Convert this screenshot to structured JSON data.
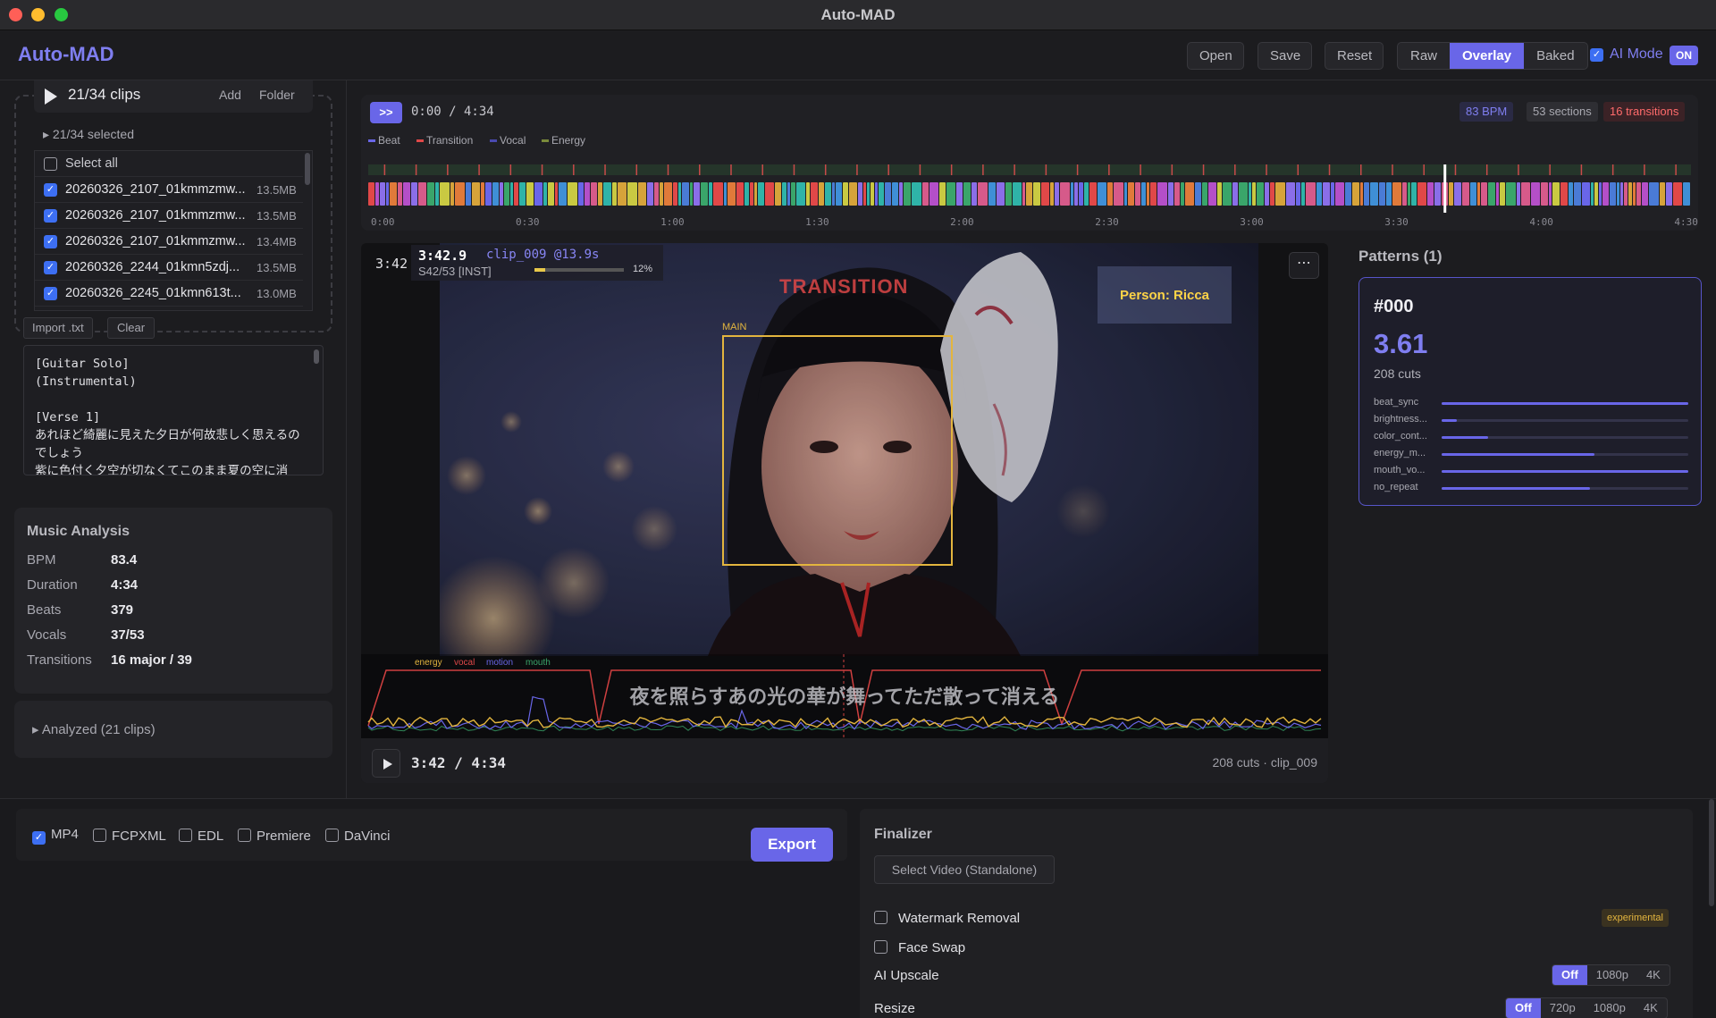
{
  "window": {
    "title": "Auto-MAD"
  },
  "header": {
    "logo": "Auto-MAD",
    "buttons": {
      "open": "Open",
      "save": "Save",
      "reset": "Reset"
    },
    "view_modes": [
      "Raw",
      "Overlay",
      "Baked"
    ],
    "active_view": "Overlay",
    "ai_mode_label": "AI Mode",
    "ai_mode_state": "ON"
  },
  "clips": {
    "count_label": "21/34 clips",
    "add_label": "Add",
    "folder_label": "Folder",
    "selected_summary": "▸ 21/34 selected",
    "select_all": "Select all",
    "items": [
      {
        "name": "20260326_2107_01kmmzmw...",
        "size": "13.5MB"
      },
      {
        "name": "20260326_2107_01kmmzmw...",
        "size": "13.5MB"
      },
      {
        "name": "20260326_2107_01kmmzmw...",
        "size": "13.4MB"
      },
      {
        "name": "20260326_2244_01kmn5zdj...",
        "size": "13.5MB"
      },
      {
        "name": "20260326_2245_01kmn613t...",
        "size": "13.0MB"
      }
    ],
    "import_label": "Import .txt",
    "clear_label": "Clear"
  },
  "lyrics": {
    "text": "[Guitar Solo]\n(Instrumental)\n\n[Verse 1]\nあれほど綺麗に見えた夕日が何故悲しく思えるのでしょう\n紫に色付く夕空が切なくてこのまま夏の空に消"
  },
  "music_analysis": {
    "title": "Music Analysis",
    "rows": [
      {
        "key": "BPM",
        "value": "83.4"
      },
      {
        "key": "Duration",
        "value": "4:34"
      },
      {
        "key": "Beats",
        "value": "379"
      },
      {
        "key": "Vocals",
        "value": "37/53"
      },
      {
        "key": "Transitions",
        "value": "16 major / 39"
      }
    ],
    "analyzed_label": "▸ Analyzed (21 clips)"
  },
  "timeline": {
    "ff_label": ">>",
    "time": "0:00 / 4:34",
    "legend": [
      {
        "name": "Beat",
        "color": "#6966e8"
      },
      {
        "name": "Transition",
        "color": "#e04848"
      },
      {
        "name": "Vocal",
        "color": "#4a4ab0"
      },
      {
        "name": "Energy",
        "color": "#7a8a3a"
      }
    ],
    "stats": {
      "bpm": "83 BPM",
      "sections": "53 sections",
      "transitions": "16 transitions"
    },
    "ticks": [
      "0:00",
      "0:30",
      "1:00",
      "1:30",
      "2:00",
      "2:30",
      "3:00",
      "3:30",
      "4:00",
      "4:30"
    ],
    "playhead_fraction": 0.814,
    "clip_palette": [
      "#e04848",
      "#6966e8",
      "#3aa56a",
      "#d6a33a",
      "#3f8fd6",
      "#b44fc8",
      "#2fb3a8",
      "#e07a3a",
      "#8a6ee8",
      "#c9c942",
      "#4a7bd6",
      "#d65a8a"
    ]
  },
  "video": {
    "side_time": "3:42",
    "osd_time": "3:42.9",
    "osd_clip": "clip_009 @13.9s",
    "osd_section": "S42/53 [INST]",
    "osd_progress_fraction": 0.12,
    "osd_progress": "12%",
    "transition_label": "TRANSITION",
    "person_label": "Person: Ricca",
    "face_tag": "MAIN",
    "subtitle": "夜を照らすあの光の華が舞ってただ散って消える",
    "overlay_legend": [
      {
        "name": "energy",
        "color": "#e3b53e"
      },
      {
        "name": "vocal",
        "color": "#e04848"
      },
      {
        "name": "motion",
        "color": "#6966e8"
      },
      {
        "name": "mouth",
        "color": "#3aa56a"
      }
    ],
    "controls_time": "3:42 / 4:34",
    "controls_info": "208 cuts · clip_009",
    "more_label": "⋯"
  },
  "patterns": {
    "title": "Patterns (1)",
    "card": {
      "id": "#000",
      "score": "3.61",
      "cuts": "208 cuts",
      "metrics": [
        {
          "name": "beat_sync",
          "value": 1.0
        },
        {
          "name": "brightness...",
          "value": 0.06
        },
        {
          "name": "color_cont...",
          "value": 0.19
        },
        {
          "name": "energy_m...",
          "value": 0.62
        },
        {
          "name": "mouth_vo...",
          "value": 1.0
        },
        {
          "name": "no_repeat",
          "value": 0.6
        }
      ]
    }
  },
  "export": {
    "formats": [
      {
        "name": "MP4",
        "checked": true
      },
      {
        "name": "FCPXML",
        "checked": false
      },
      {
        "name": "EDL",
        "checked": false
      },
      {
        "name": "Premiere",
        "checked": false
      },
      {
        "name": "DaVinci",
        "checked": false
      }
    ],
    "button": "Export"
  },
  "finalizer": {
    "title": "Finalizer",
    "select_video": "Select Video (Standalone)",
    "watermark": "Watermark Removal",
    "face_swap": "Face Swap",
    "experimental": "experimental",
    "ai_upscale_label": "AI Upscale",
    "ai_upscale_options": [
      "Off",
      "1080p",
      "4K"
    ],
    "resize_label": "Resize",
    "resize_options": [
      "Off",
      "720p",
      "1080p",
      "4K"
    ]
  }
}
